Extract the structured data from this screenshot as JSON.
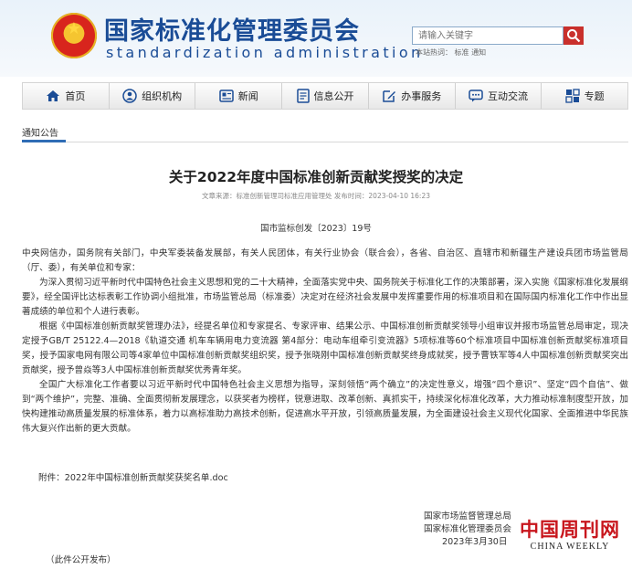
{
  "header": {
    "site_name": "国家标准化管理委员会",
    "site_name_en": "standardization administration",
    "search_placeholder": "请输入关键字",
    "hot_searches": "本站热词： 标准 通知"
  },
  "nav": {
    "items": [
      {
        "label": "首页",
        "icon": "home-icon"
      },
      {
        "label": "组织机构",
        "icon": "org-icon"
      },
      {
        "label": "新闻",
        "icon": "news-icon"
      },
      {
        "label": "信息公开",
        "icon": "document-icon"
      },
      {
        "label": "办事服务",
        "icon": "edit-icon"
      },
      {
        "label": "互动交流",
        "icon": "chat-icon"
      },
      {
        "label": "专题",
        "icon": "topic-icon"
      }
    ]
  },
  "breadcrumb": "通知公告",
  "article": {
    "title": "关于2022年度中国标准创新贡献奖授奖的决定",
    "meta": "文章来源：标准创新管理司标准应用管理处 发布时间：2023-04-10 16:23",
    "doc_number": "国市监标创发〔2023〕19号",
    "paragraphs": [
      "中央网信办，国务院有关部门，中央军委装备发展部，有关人民团体，有关行业协会（联合会），各省、自治区、直辖市和新疆生产建设兵团市场监管局（厅、委），有关单位和专家：",
      "为深入贯彻习近平新时代中国特色社会主义思想和党的二十大精神，全面落实党中央、国务院关于标准化工作的决策部署，深入实施《国家标准化发展纲要》，经全国评比达标表彰工作协调小组批准，市场监管总局（标准委）决定对在经济社会发展中发挥重要作用的标准项目和在国际国内标准化工作中作出显著成绩的单位和个人进行表彰。",
      "根据《中国标准创新贡献奖管理办法》，经提名单位和专家提名、专家评审、结果公示、中国标准创新贡献奖领导小组审议并报市场监管总局审定，现决定授予GB/T 25122.4—2018《轨道交通 机车车辆用电力变流器 第4部分：电动车组牵引变流器》5项标准等60个标准项目中国标准创新贡献奖标准项目奖，授予国家电网有限公司等4家单位中国标准创新贡献奖组织奖，授予张晓刚中国标准创新贡献奖终身成就奖，授予曹铁军等4人中国标准创新贡献奖突出贡献奖，授予曾焱等3人中国标准创新贡献奖优秀青年奖。",
      "全国广大标准化工作者要以习近平新时代中国特色社会主义思想为指导，深刻领悟“两个确立”的决定性意义，增强“四个意识”、坚定“四个自信”、做到“两个维护”，完整、准确、全面贯彻新发展理念，以获奖者为榜样，锐意进取、改革创新、真抓实干，持续深化标准化改革，大力推动标准制度型开放，加快构建推动高质量发展的标准体系，着力以高标准助力高技术创新，促进高水平开放，引领高质量发展，为全面建设社会主义现代化国家、全面推进中华民族伟大复兴作出新的更大贡献。"
    ],
    "attachment": "附件：2022年中国标准创新贡献奖获奖名单.doc",
    "signatures": [
      "国家市场监督管理总局",
      "国家标准化管理委员会"
    ],
    "date": "2023年3月30日",
    "footnote": "（此件公开发布）"
  },
  "watermark": {
    "cn": "中国周刊网",
    "en": "CHINA WEEKLY"
  },
  "colors": {
    "brand_blue": "#1a4c96",
    "accent_red": "#c8161d",
    "search_red": "#c9302c"
  }
}
